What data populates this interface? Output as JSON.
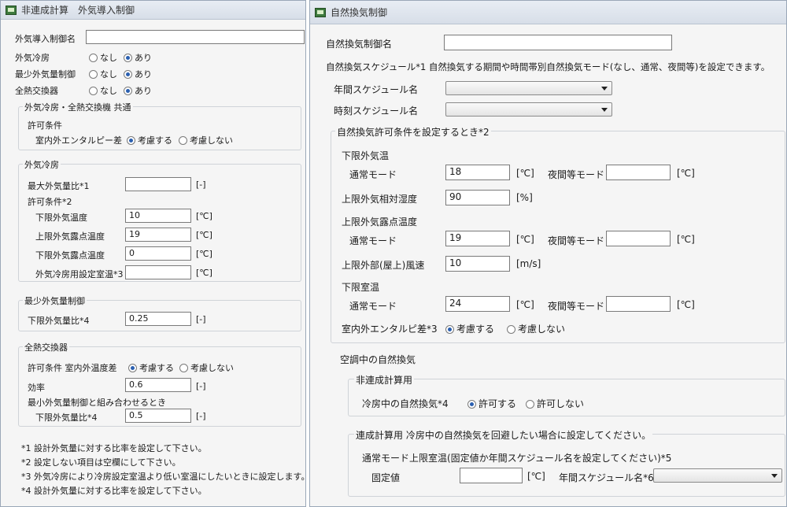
{
  "left": {
    "title": "非連成計算　外気導入制御",
    "name_label": "外気導入制御名",
    "oa_cooling_label": "外気冷房",
    "min_oa_label": "最少外気量制御",
    "hx_label": "全熱交換器",
    "opt_nashi": "なし",
    "opt_ari": "あり",
    "common_group": "外気冷房・全熱交換機 共通",
    "permit_cond": "許可条件",
    "enthalpy_label": "室内外エンタルピー差",
    "consider": "考慮する",
    "not_consider": "考慮しない",
    "oac_group": "外気冷房",
    "max_oa_ratio": "最大外気量比*1",
    "unit_dimless": "[-]",
    "permit_cond2": "許可条件*2",
    "low_oa_temp": "下限外気温度",
    "low_oa_temp_val": "10",
    "high_dew": "上限外気露点温度",
    "high_dew_val": "19",
    "low_dew": "下限外気露点温度",
    "low_dew_val": "0",
    "oac_setpoint": "外気冷房用設定室温*3",
    "unit_c": "[℃]",
    "min_group": "最少外気量制御",
    "low_oa_ratio": "下限外気量比*4",
    "low_oa_ratio_val": "0.25",
    "hx_group": "全熱交換器",
    "hx_permit": "許可条件 室内外温度差",
    "efficiency": "効率",
    "efficiency_val": "0.6",
    "combine_note": "最小外気量制御と組み合わせるとき",
    "hx_low_ratio": "下限外気量比*4",
    "hx_low_ratio_val": "0.5",
    "notes": [
      "*1 設計外気量に対する比率を設定して下さい。",
      "*2 設定しない項目は空欄にして下さい。",
      "*3 外気冷房により冷房設定室温より低い室温にしたいときに設定します。",
      "*4 設計外気量に対する比率を設定して下さい。"
    ]
  },
  "right": {
    "title": "自然換気制御",
    "name_label": "自然換気制御名",
    "schedule_note": "自然換気スケジュール*1 自然換気する期間や時間帯別自然換気モード(なし、通常、夜間等)を設定できます。",
    "annual_sched": "年間スケジュール名",
    "hourly_sched": "時刻スケジュール名",
    "permit_group": "自然換気許可条件を設定するとき*2",
    "low_oa_temp": "下限外気温",
    "normal_mode": "通常モード",
    "night_mode": "夜間等モード",
    "unit_c": "[℃]",
    "unit_pct": "[%]",
    "unit_ms": "[m/s]",
    "low_oa_temp_val": "18",
    "high_rh": "上限外気相対湿度",
    "high_rh_val": "90",
    "high_dew": "上限外気露点温度",
    "high_dew_val": "19",
    "high_wind": "上限外部(屋上)風速",
    "high_wind_val": "10",
    "low_room": "下限室温",
    "low_room_val": "24",
    "enthalpy": "室内外エンタルピ差*3",
    "consider": "考慮する",
    "not_consider": "考慮しない",
    "ac_nv": "空調中の自然換気",
    "noncoupled": "非連成計算用",
    "cooling_nv": "冷房中の自然換気*4",
    "permit": "許可する",
    "not_permit": "許可しない",
    "coupled": "連成計算用 冷房中の自然換気を回避したい場合に設定してください。",
    "upper_room": "通常モード上限室温(固定値か年間スケジュール名を設定してください)*5",
    "fixed": "固定値",
    "annual_sched6": "年間スケジュール名*6"
  }
}
